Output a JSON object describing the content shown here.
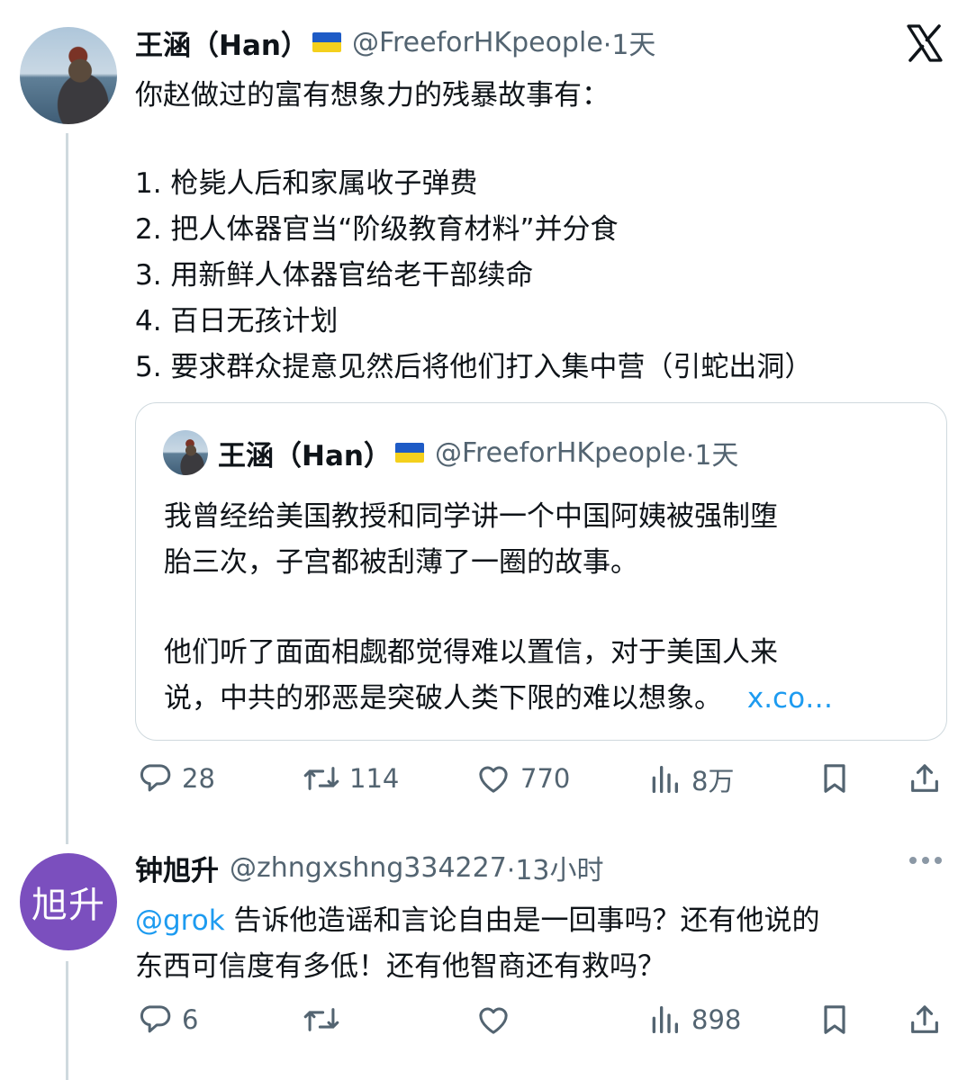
{
  "tweet": {
    "author_name": "王涵（Han）",
    "handle": "@FreeforHKpeople",
    "time": "·1天",
    "lines": [
      "你赵做过的富有想象力的残暴故事有：",
      "1. 枪毙人后和家属收子弹费",
      "2. 把人体器官当“阶级教育材料”并分食",
      "3. 用新鲜人体器官给老干部续命",
      "4. 百日无孩计划",
      "5. 要求群众提意见然后将他们打入集中营（引蛇出洞）"
    ],
    "quoted": {
      "author_name": "王涵（Han）",
      "handle": "@FreeforHKpeople",
      "time": "·1天",
      "lines": [
        "我曾经给美国教授和同学讲一个中国阿姨被强制堕",
        "胎三次，子宫都被刮薄了一圈的故事。",
        "他们听了面面相觑都觉得难以置信，对于美国人来",
        "说，中共的邪恶是突破人类下限的难以想象。"
      ],
      "link": "x.co…"
    },
    "actions": {
      "replies": "28",
      "reposts": "114",
      "likes": "770",
      "views": "8万"
    }
  },
  "reply": {
    "avatar_text": "旭升",
    "author_name": "钟旭升",
    "handle": "@zhngxshng334227",
    "time": "·13小时",
    "mention": "@grok",
    "line1": " 告诉他造谣和言论自由是一回事吗？还有他说的",
    "line2": "东西可信度有多低！还有他智商还有救吗？",
    "actions": {
      "replies": "6",
      "views": "898"
    }
  },
  "icons": {
    "x_logo": "x-logo-icon",
    "flag": "ukraine-flag-icon",
    "more": "more-options-icon"
  },
  "colors": {
    "link": "#1d9bf0",
    "secondary_text": "#536471",
    "avatar_purple": "#7b4fbe"
  }
}
